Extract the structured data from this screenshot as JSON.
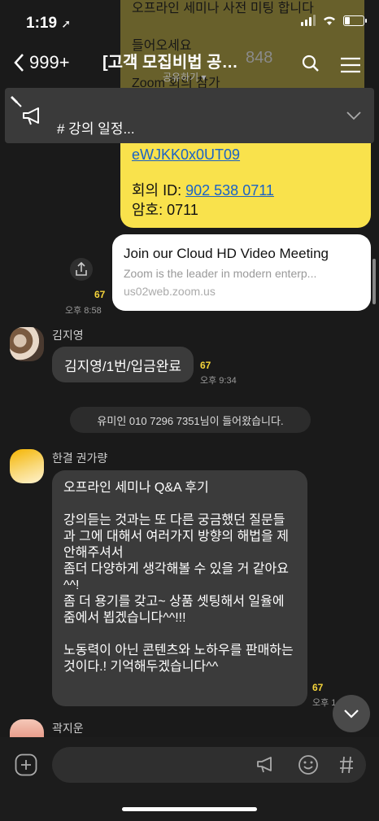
{
  "status": {
    "time": "1:19"
  },
  "header": {
    "back_count": "999+",
    "title": "[고객 모집비법 공부...",
    "member_count": "848",
    "share_label": "공유하기 ▾"
  },
  "notice": {
    "text": "# 강의 일정..."
  },
  "bg_ghost": {
    "line1": "오프라인 세미나 사전 미팅 합니다",
    "line2": "들어오세요",
    "line3": "Zoom 회의 참가"
  },
  "messages": {
    "zoom": {
      "link_tail": "eWJKK0x0UT09",
      "meeting_id_label": "회의 ID: ",
      "meeting_id": "902 538 0711",
      "password": "암호: 0711"
    },
    "preview": {
      "title": "Join our Cloud HD Video Meeting",
      "desc": "Zoom is the leader in modern enterp...",
      "domain": "us02web.zoom.us",
      "count": "67",
      "time": "오후 8:58"
    },
    "kim": {
      "sender": "김지영",
      "text": "김지영/1번/입금완료",
      "count": "67",
      "time": "오후 9:34"
    },
    "system": "유미인  010  7296  7351님이 들어왔습니다.",
    "kwon": {
      "sender": "한결 권가량",
      "text": "오프라인 세미나 Q&A 후기\n\n강의듣는 것과는 또 다른 궁금했던 질문들과 그에 대해서 여러가지 방향의 해법을 제안해주셔서\n좀더 다양하게 생각해볼 수 있을 거 같아요^^!\n좀 더 용기를 갖고~ 상품 셋팅해서 일율에 줌에서 뵙겠습니다^^!!!\n\n노동력이 아닌 콘텐츠와 노하우를 판매하는 것이다.! 기억해두겠습니다^^",
      "count": "67",
      "time": "오후 1"
    },
    "kwak": {
      "sender": "곽지운"
    }
  }
}
